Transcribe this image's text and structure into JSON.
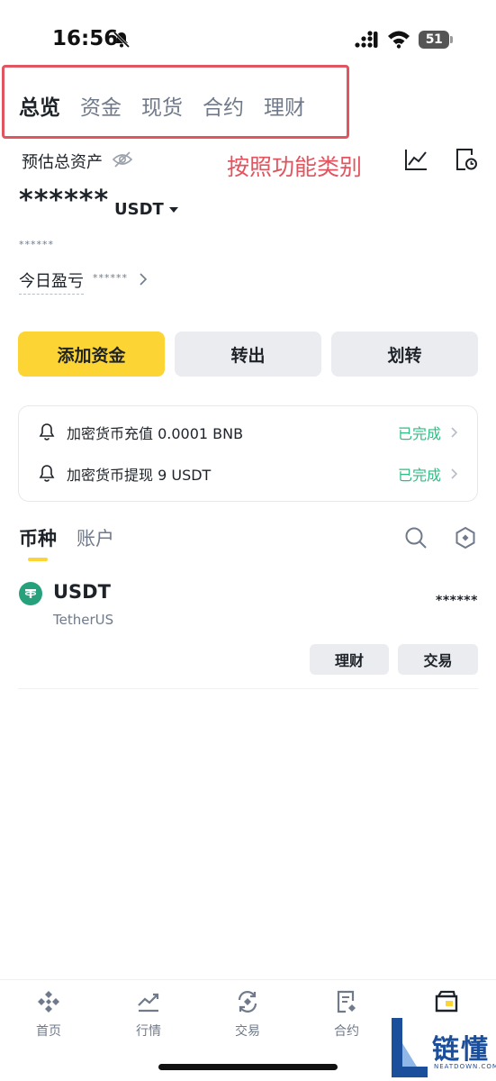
{
  "status_bar": {
    "time": "16:56",
    "battery": "51"
  },
  "top_tabs": [
    {
      "label": "总览",
      "active": true
    },
    {
      "label": "资金",
      "active": false
    },
    {
      "label": "现货",
      "active": false
    },
    {
      "label": "合约",
      "active": false
    },
    {
      "label": "理财",
      "active": false
    }
  ],
  "annotation": "按照功能类别",
  "asset_summary": {
    "label": "预估总资产",
    "balance_masked": "******",
    "currency": "USDT",
    "equivalent_masked": "******",
    "pnl_label": "今日盈亏",
    "pnl_masked": "******"
  },
  "actions": {
    "add_funds": "添加资金",
    "withdraw": "转出",
    "transfer": "划转"
  },
  "notifications": [
    {
      "text": "加密货币充值 0.0001 BNB",
      "status": "已完成"
    },
    {
      "text": "加密货币提现 9 USDT",
      "status": "已完成"
    }
  ],
  "list_tabs": {
    "coin": "币种",
    "account": "账户"
  },
  "assets": [
    {
      "symbol": "USDT",
      "name": "TetherUS",
      "amount_masked": "******",
      "earn_label": "理财",
      "trade_label": "交易"
    }
  ],
  "bottom_nav": [
    {
      "label": "首页",
      "icon": "home-icon"
    },
    {
      "label": "行情",
      "icon": "markets-icon"
    },
    {
      "label": "交易",
      "icon": "trade-icon"
    },
    {
      "label": "合约",
      "icon": "futures-icon"
    },
    {
      "label": "",
      "icon": "wallet-icon"
    }
  ],
  "watermark": {
    "text": "链懂",
    "sub": "NEATDOWN.COM"
  },
  "colors": {
    "accent": "#fcd535",
    "success": "#2ebd85",
    "annotation": "#e0555f",
    "text": "#1e2329",
    "muted": "#707a8a"
  }
}
